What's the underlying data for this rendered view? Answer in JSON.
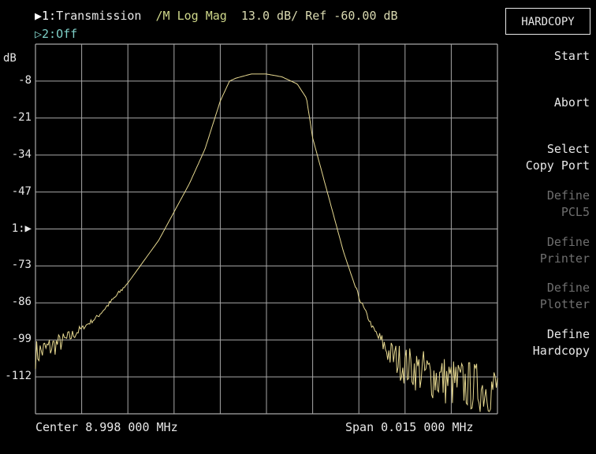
{
  "header": {
    "channel1": {
      "marker": "▶1:",
      "name": "Transmission",
      "format": "/M Log Mag",
      "scale": "13.0 dB/",
      "reference": "Ref -60.00 dB"
    },
    "channel2": {
      "marker": "▷2:",
      "state": "Off"
    }
  },
  "y_axis": {
    "unit": "dB",
    "tick_labels": [
      "-8",
      "-21",
      "-34",
      "-47",
      "1:▶",
      "-73",
      "-86",
      "-99",
      "-112"
    ],
    "reference_marker_label": "1:▶"
  },
  "footer": {
    "center": "Center 8.998 000 MHz",
    "span": "Span 0.015 000 MHz"
  },
  "softkey_menu": {
    "title": "HARDCOPY",
    "items": [
      {
        "label": "Start",
        "enabled": true
      },
      {
        "label": "Abort",
        "enabled": true
      },
      {
        "label": "Select\nCopy Port",
        "enabled": true
      },
      {
        "label": "Define\nPCL5",
        "enabled": false
      },
      {
        "label": "Define\nPrinter",
        "enabled": false
      },
      {
        "label": "Define\nPlotter",
        "enabled": false
      },
      {
        "label": "Define\nHardcopy",
        "enabled": true
      }
    ]
  },
  "chart_data": {
    "type": "line",
    "title": "",
    "xlabel": "",
    "ylabel": "dB",
    "x_center_mhz": 8.998,
    "x_span_mhz": 0.015,
    "x_unit": "MHz",
    "xlim": [
      8.9905,
      9.0055
    ],
    "ylim": [
      -125,
      5
    ],
    "grid": true,
    "grid_divisions": {
      "x": 10,
      "y": 10
    },
    "trace_color": "#e6d890",
    "series": [
      {
        "x": [
          8.9905,
          8.9915,
          8.9925,
          8.9935,
          8.9945,
          8.9955,
          8.996,
          8.9965,
          8.9968,
          8.997,
          8.9975,
          8.998,
          8.9985,
          8.999,
          8.9993,
          8.9995,
          9.0,
          9.0005,
          9.001,
          9.0015,
          9.002,
          9.0025,
          9.003,
          9.004,
          9.005,
          9.0055
        ],
        "y": [
          -104,
          -99,
          -91,
          -79,
          -64,
          -44,
          -32,
          -15,
          -8,
          -7,
          -5.5,
          -5.5,
          -6.5,
          -9,
          -14,
          -28,
          -48,
          -68,
          -84,
          -96,
          -104,
          -108,
          -110,
          -114,
          -116,
          -116
        ]
      }
    ]
  },
  "colors": {
    "background": "#000000",
    "grid": "#a8a8a8",
    "trace": "#e6d890",
    "text": "#e8e8e8",
    "channel2_text": "#7fd0c8",
    "disabled_softkey": "#6f6f6f"
  }
}
